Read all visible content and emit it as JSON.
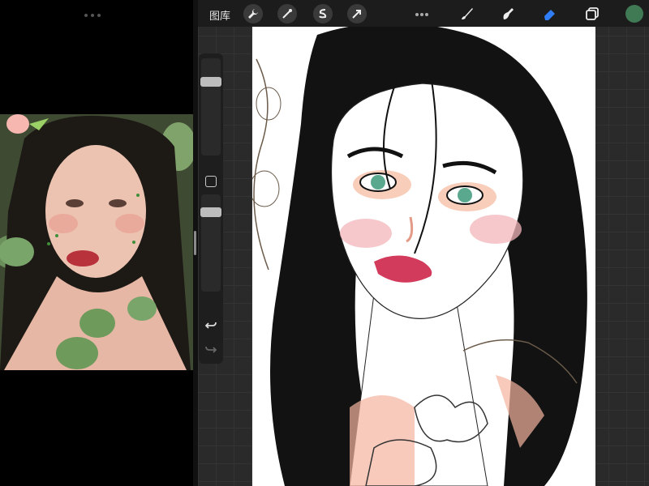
{
  "toolbar": {
    "gallery_label": "图库",
    "tools": [
      {
        "icon": "wrench-icon"
      },
      {
        "icon": "magic-wand-icon"
      },
      {
        "icon": "selection-icon"
      },
      {
        "icon": "transform-arrow-icon"
      }
    ],
    "right_tools": [
      {
        "icon": "brush-icon"
      },
      {
        "icon": "smudge-icon"
      },
      {
        "icon": "eraser-icon"
      },
      {
        "icon": "layers-icon"
      }
    ],
    "current_color": "#3f7a55",
    "eraser_active_color": "#2f7ef7"
  },
  "sidebar": {
    "undo_icon": "undo-icon",
    "redo_icon": "redo-icon",
    "modify_icon": "square-modify-icon"
  },
  "reference_image": {
    "description_icon": "reference-photo"
  }
}
